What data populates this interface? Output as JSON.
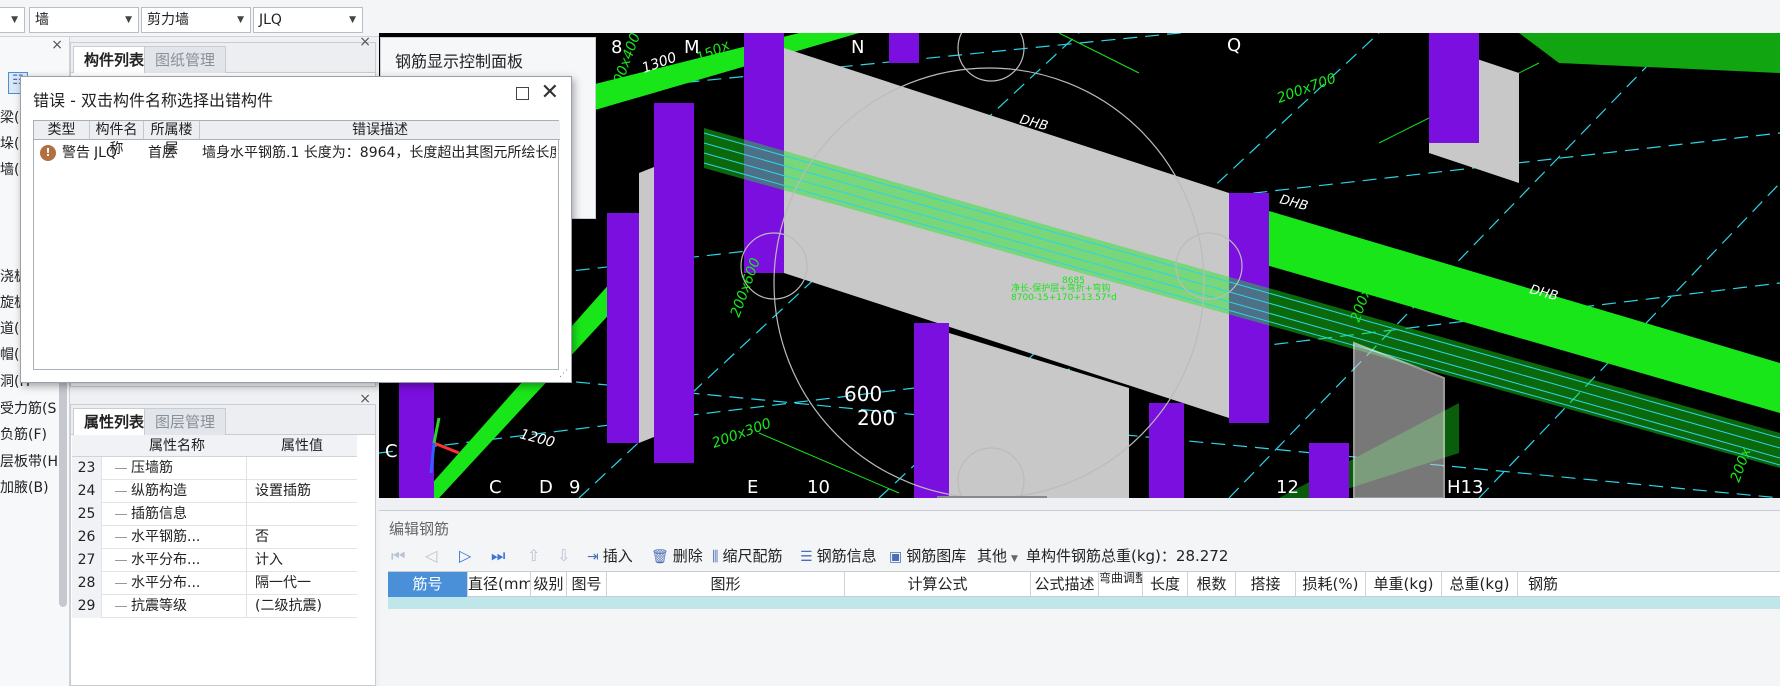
{
  "topbar": {
    "combos": [
      {
        "value": "",
        "name": "floor-select"
      },
      {
        "value": "墙",
        "name": "category-select"
      },
      {
        "value": "剪力墙",
        "name": "type-select"
      },
      {
        "value": "JLQ",
        "name": "component-select"
      }
    ]
  },
  "left_strip": {
    "items": [
      "梁(",
      "垛(",
      "墙(",
      "浇板",
      "旋板",
      "道(",
      "帽(",
      "洞(H",
      "受力筋(S",
      "负筋(F)",
      "层板带(H",
      "加腋(B)"
    ]
  },
  "component_panel": {
    "tabs": [
      "构件列表",
      "图纸管理"
    ]
  },
  "property_panel": {
    "tabs": [
      "属性列表",
      "图层管理"
    ],
    "headers": {
      "name": "属性名称",
      "value": "属性值"
    },
    "rows": [
      {
        "num": "23",
        "name": "压墙筋",
        "value": ""
      },
      {
        "num": "24",
        "name": "纵筋构造",
        "value": "设置插筋"
      },
      {
        "num": "25",
        "name": "插筋信息",
        "value": ""
      },
      {
        "num": "26",
        "name": "水平钢筋...",
        "value": "否"
      },
      {
        "num": "27",
        "name": "水平分布...",
        "value": "计入"
      },
      {
        "num": "28",
        "name": "水平分布...",
        "value": "隔一代一"
      },
      {
        "num": "29",
        "name": "抗震等级",
        "value": "(二级抗震)"
      }
    ]
  },
  "control_panel": {
    "title": "钢筋显示控制面板"
  },
  "error_dialog": {
    "title": "错误 - 双击构件名称选择出错构件",
    "headers": [
      "类型",
      "构件名称",
      "所属楼层",
      "错误描述"
    ],
    "rows": [
      {
        "type": "警告",
        "component": "JLQ",
        "floor": "首层",
        "description": "墙身水平钢筋.1 长度为：8964，长度超出其图元所绘长度..."
      }
    ]
  },
  "viewport": {
    "axis_labels": [
      "8",
      "M",
      "N",
      "Q",
      "C",
      "C",
      "D",
      "9",
      "E",
      "10",
      "12",
      "H13"
    ],
    "dim_labels": [
      "200x400",
      "1300",
      "150x",
      "200x700",
      "DHB",
      "DHB",
      "DHB",
      "200x600",
      "600",
      "200",
      "200x300",
      "1200",
      "200x",
      "200x"
    ],
    "annotation_lines": [
      "8685",
      "净长-保护层+弯折+弯钩",
      "8700-15+170+13.57*d"
    ]
  },
  "edit_panel": {
    "title": "编辑钢筋",
    "toolbar": {
      "insert": "插入",
      "delete": "删除",
      "scale": "缩尺配筋",
      "info": "钢筋信息",
      "library": "钢筋图库",
      "other": "其他",
      "total_label": "单构件钢筋总重(kg)：28.272"
    },
    "columns": [
      "筋号",
      "直径(mm)",
      "级别",
      "图号",
      "图形",
      "计算公式",
      "公式描述",
      "弯曲调整",
      "长度",
      "根数",
      "搭接",
      "损耗(%)",
      "单重(kg)",
      "总重(kg)",
      "钢筋"
    ]
  },
  "colors": {
    "green": "#19e619",
    "purple": "#7a0fe0",
    "wall_gray": "#c8c8c8",
    "cyan": "#2ad6e8",
    "accent_blue": "#4a90d9"
  }
}
